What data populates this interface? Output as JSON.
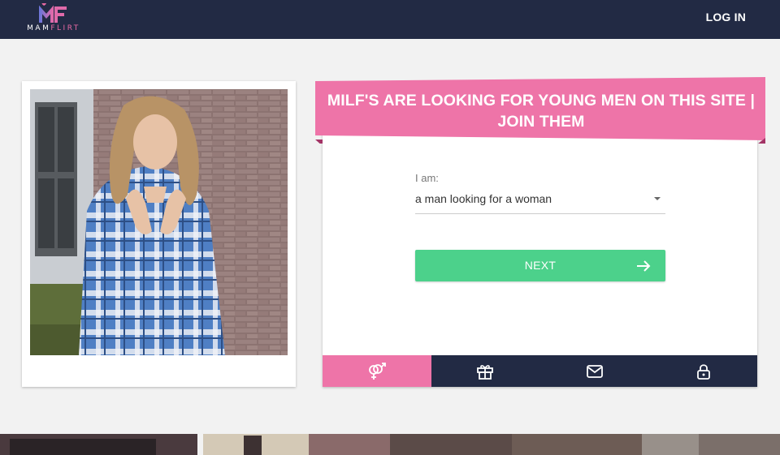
{
  "header": {
    "logo": {
      "monogram": "MF",
      "word_a": "MAM",
      "word_b": "FLIRT"
    },
    "login_label": "LOG IN"
  },
  "photo_card": {
    "image": "woman-in-plaid-shirt-photo"
  },
  "hero": {
    "headline_line1": "MILF'S ARE LOOKING FOR YOUNG MEN ON THIS SITE |",
    "headline_line2": "JOIN THEM"
  },
  "form": {
    "field_label": "I am:",
    "selected_option": "a man looking for a woman",
    "next_label": "NEXT"
  },
  "tabs": [
    {
      "icon": "gender-symbol-icon",
      "active": true
    },
    {
      "icon": "gift-icon",
      "active": false
    },
    {
      "icon": "envelope-icon",
      "active": false
    },
    {
      "icon": "lock-icon",
      "active": false
    }
  ],
  "colors": {
    "header_bg": "#222a44",
    "accent_pink": "#ee74a8",
    "button_green": "#4cd18b",
    "page_bg": "#f2f2f2"
  }
}
